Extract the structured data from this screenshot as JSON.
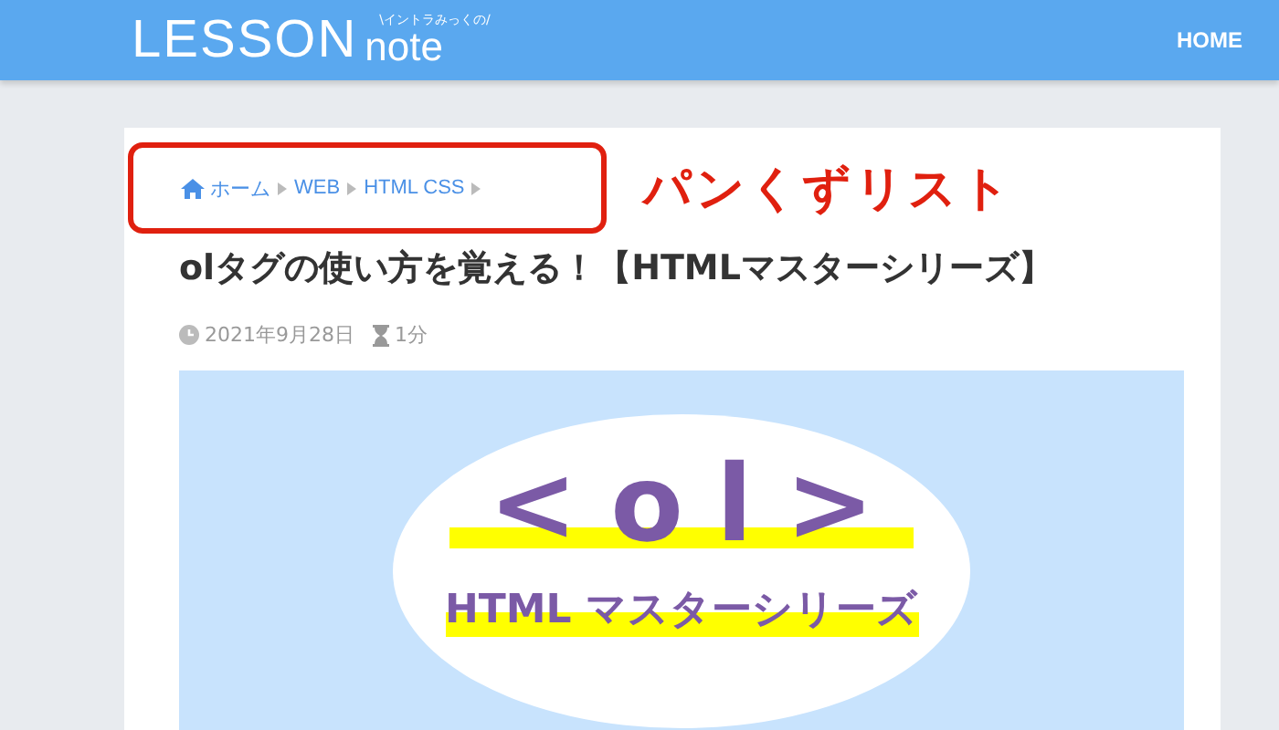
{
  "header": {
    "logo": {
      "tagline": "\\イントラみっくの/",
      "main": "LESSON",
      "sub": "note"
    },
    "nav": [
      {
        "label": "HOME"
      }
    ]
  },
  "breadcrumb": {
    "items": [
      {
        "label": "ホーム",
        "kind": "home"
      },
      {
        "label": "WEB",
        "kind": "link"
      },
      {
        "label": "HTML CSS",
        "kind": "link"
      }
    ]
  },
  "annotation": {
    "label": "パンくずリスト"
  },
  "article": {
    "title": "olタグの使い方を覚える！【HTMLマスターシリーズ】",
    "date": "2021年9月28日",
    "reading_time": "1分"
  },
  "banner": {
    "code": "<ol>",
    "caption": "HTML マスターシリーズ"
  }
}
